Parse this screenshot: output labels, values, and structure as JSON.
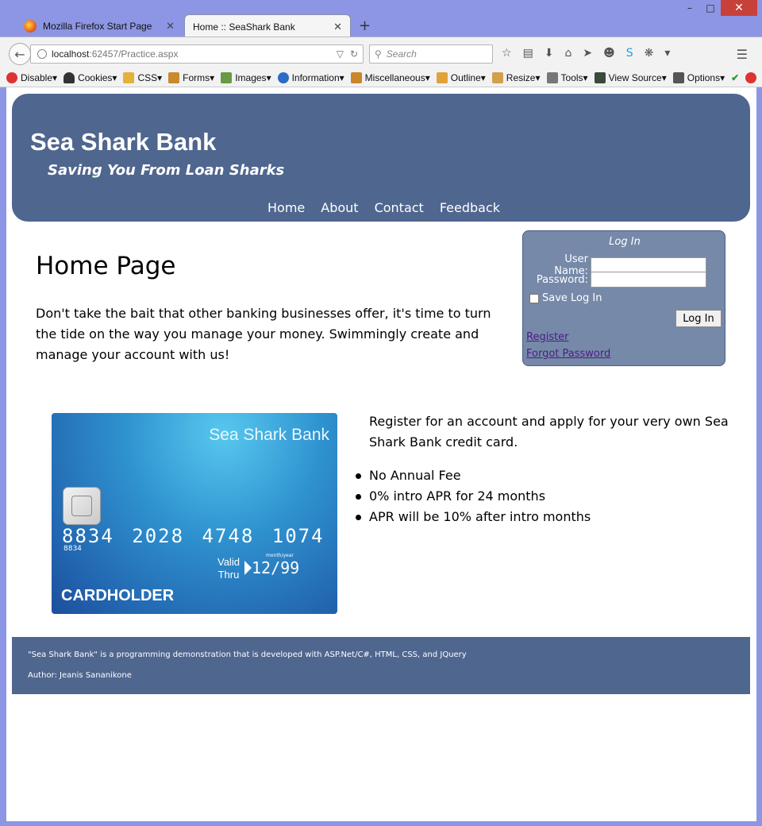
{
  "browser": {
    "tabs": [
      {
        "label": "Mozilla Firefox Start Page"
      },
      {
        "label": "Home :: SeaShark Bank"
      }
    ],
    "url_host": "localhost",
    "url_rest": ":62457/Practice.aspx",
    "search_placeholder": "Search",
    "webdev_toolbar": [
      "Disable",
      "Cookies",
      "CSS",
      "Forms",
      "Images",
      "Information",
      "Miscellaneous",
      "Outline",
      "Resize",
      "Tools",
      "View Source",
      "Options"
    ]
  },
  "site": {
    "title": "Sea Shark Bank",
    "tagline": "Saving You From Loan Sharks",
    "nav": [
      "Home",
      "About",
      "Contact",
      "Feedback"
    ]
  },
  "login": {
    "title": "Log In",
    "username_label": "User Name:",
    "password_label": "Password:",
    "remember_label": "Save Log In",
    "button": "Log In",
    "register_link": "Register",
    "forgot_link": "Forgot Password"
  },
  "main": {
    "heading": "Home Page",
    "intro": "Don't take the bait that other banking businesses offer, it's time to turn the tide on the way you manage your money. Swimmingly create and manage your account with us!",
    "promo": "Register for an account and apply for your very own Sea Shark Bank credit card.",
    "features": [
      "No Annual Fee",
      "0% intro APR for 24 months",
      "APR will be 10% after intro months"
    ]
  },
  "card": {
    "bank": "Sea Shark Bank",
    "number": "8834 2028 4748 1074",
    "small": "8834",
    "month_year": "month/year",
    "valid": "Valid",
    "thru": "Thru",
    "expiry": "12/99",
    "holder": "CARDHOLDER"
  },
  "footer": {
    "line1": "\"Sea Shark Bank\" is a programming demonstration that is developed with ASP.Net/C#, HTML, CSS, and JQuery",
    "line2": "Author: Jeanis Sananikone"
  },
  "colors": {
    "header_bg": "#4f668f",
    "login_bg": "#7689a9",
    "link_visited": "#4b1e84"
  }
}
